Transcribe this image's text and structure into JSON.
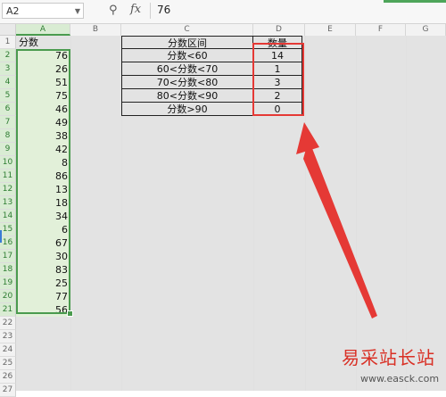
{
  "formula_bar": {
    "cell_ref": "A2",
    "fx_label": "fx",
    "value": "76"
  },
  "columns": [
    "A",
    "B",
    "C",
    "D",
    "E",
    "F",
    "G"
  ],
  "rows": [
    "1",
    "2",
    "3",
    "4",
    "5",
    "6",
    "7",
    "8",
    "9",
    "10",
    "11",
    "12",
    "13",
    "14",
    "15",
    "16",
    "17",
    "18",
    "19",
    "20",
    "21",
    "22",
    "23",
    "24",
    "25",
    "26",
    "27"
  ],
  "col_a": [
    "分数",
    "76",
    "26",
    "51",
    "75",
    "46",
    "49",
    "38",
    "42",
    "8",
    "86",
    "13",
    "18",
    "34",
    "6",
    "67",
    "30",
    "83",
    "25",
    "77",
    "56"
  ],
  "table_c": [
    "分数区间",
    "分数<60",
    "60<分数<70",
    "70<分数<80",
    "80<分数<90",
    "分数>90"
  ],
  "table_d": [
    "数量",
    "14",
    "1",
    "3",
    "2",
    "0"
  ],
  "watermark": {
    "text": "易采站长站",
    "url": "www.easck.com"
  },
  "colors": {
    "selection": "#4a9b4e",
    "annotation": "#e53935",
    "watermark": "#d93025"
  }
}
